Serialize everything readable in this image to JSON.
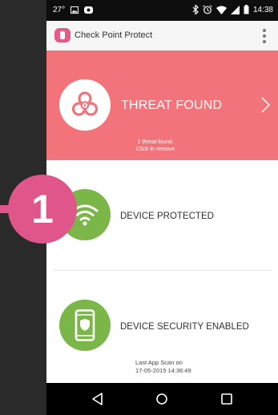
{
  "status_bar": {
    "temperature": "27°",
    "time": "14:38"
  },
  "app": {
    "title": "Check Point Protect"
  },
  "threat": {
    "title": "THREAT FOUND",
    "subtitle_line1": "1 threat found.",
    "subtitle_line2": "Click to remove"
  },
  "status_rows": [
    {
      "label": "DEVICE PROTECTED"
    },
    {
      "label": "DEVICE SECURITY ENABLED"
    }
  ],
  "scan": {
    "line1": "Last App Scan on",
    "line2": "17-05-2015 14:36:49"
  },
  "badge": {
    "number": "1"
  },
  "colors": {
    "threat_bg": "#f2737a",
    "ok_green": "#7ab648",
    "badge_pink": "#e0568a"
  }
}
